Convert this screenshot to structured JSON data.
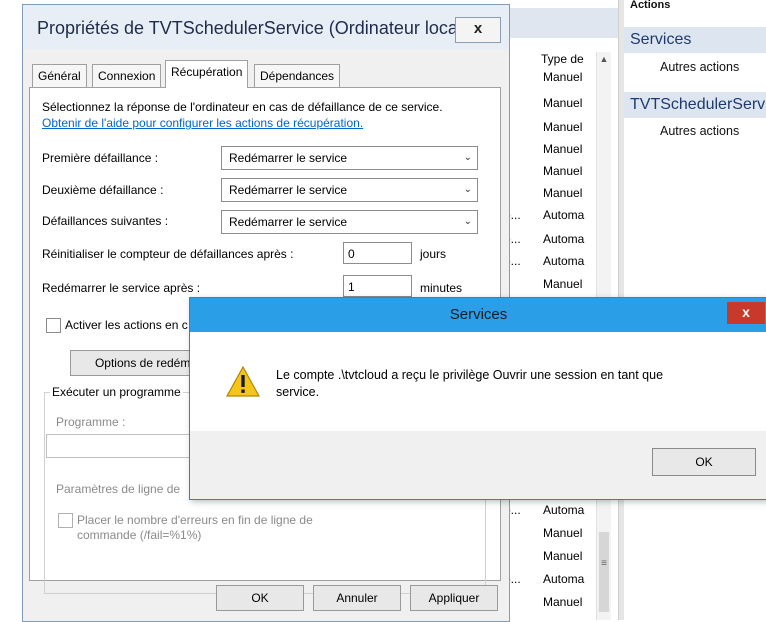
{
  "background": {
    "type_column_header": "Type de",
    "type_values": [
      "Manuel",
      "Manuel",
      "Manuel",
      "Manuel",
      "Manuel",
      "Manuel",
      "Automa",
      "Automa",
      "Automa",
      "Manuel",
      "Automa",
      "Manuel",
      "Manuel",
      "Automa",
      "Manuel"
    ],
    "truncated_label": "p..."
  },
  "actions_pane": {
    "header": "Actions",
    "sections": [
      {
        "title": "Services",
        "item": "Autres actions"
      },
      {
        "title": "TVTSchedulerServ",
        "item": "Autres actions"
      }
    ]
  },
  "properties_dialog": {
    "title": "Propriétés de TVTSchedulerService (Ordinateur local)",
    "close_label": "x",
    "tabs": [
      "Général",
      "Connexion",
      "Récupération",
      "Dépendances"
    ],
    "active_tab": "Récupération",
    "intro_text": "Sélectionnez la réponse de l'ordinateur en cas de défaillance de ce service.",
    "help_link": "Obtenir de l'aide pour configurer les actions de récupération.",
    "first_failure_label": "Première défaillance :",
    "first_failure_value": "Redémarrer le service",
    "second_failure_label": "Deuxième défaillance :",
    "second_failure_value": "Redémarrer le service",
    "subsequent_failures_label": "Défaillances suivantes :",
    "subsequent_failures_value": "Redémarrer le service",
    "reset_counter_label": "Réinitialiser le compteur de défaillances après :",
    "reset_counter_value": "0",
    "reset_counter_unit": "jours",
    "restart_after_label": "Redémarrer le service après :",
    "restart_after_value": "1",
    "restart_after_unit": "minutes",
    "enable_actions_label": "Activer les actions en c",
    "restart_options_button": "Options de redéma",
    "run_program_group_label": "Exécuter un programme",
    "program_label": "Programme :",
    "cmdline_params_label": "Paramètres de ligne de",
    "append_fail_count_label_line1": "Placer le nombre d'erreurs en fin de ligne de",
    "append_fail_count_label_line2": "commande (/fail=%1%)",
    "ok_button": "OK",
    "cancel_button": "Annuler",
    "apply_button": "Appliquer"
  },
  "message_box": {
    "title": "Services",
    "close_label": "x",
    "message_line1": "Le compte .\\tvtcloud a reçu le privilège Ouvrir une session en tant que",
    "message_line2": "service.",
    "ok_button": "OK",
    "icon": "warning-icon"
  }
}
